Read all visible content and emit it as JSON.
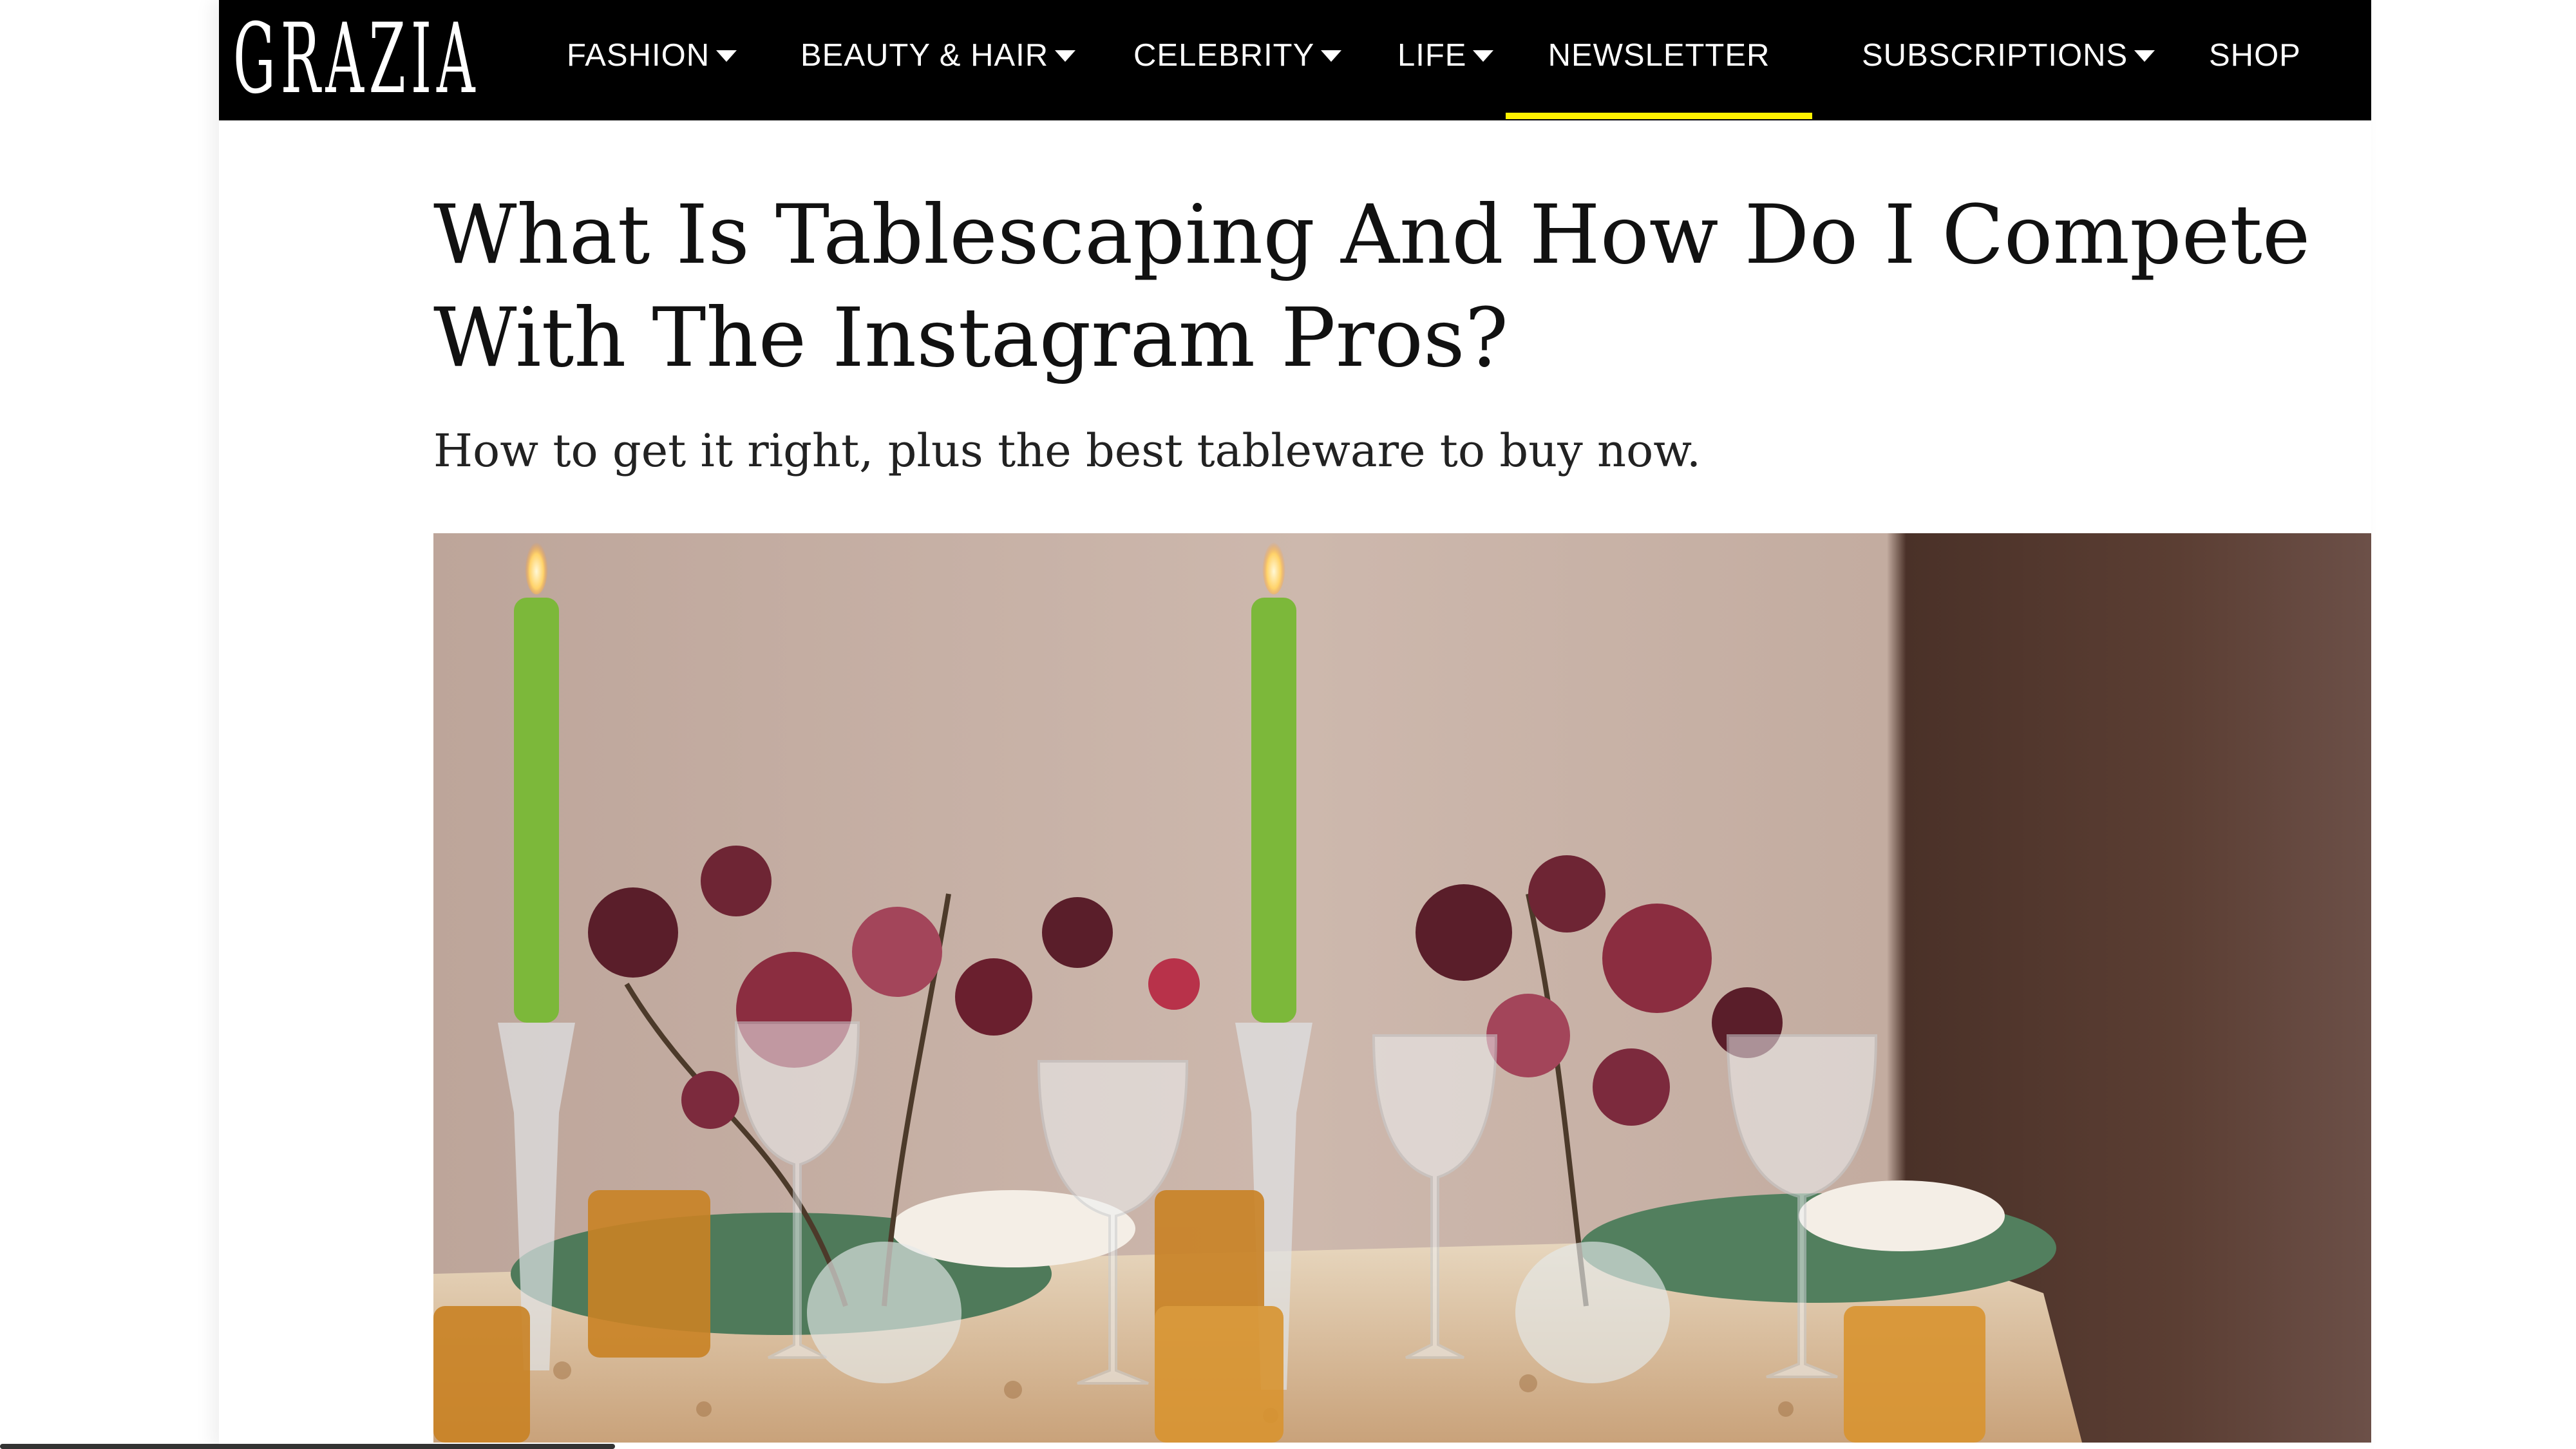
{
  "brand": {
    "logo_text": "GRAZIA"
  },
  "nav": {
    "items": [
      {
        "label": "FASHION",
        "has_dropdown": true
      },
      {
        "label": "BEAUTY & HAIR",
        "has_dropdown": true
      },
      {
        "label": "CELEBRITY",
        "has_dropdown": true
      },
      {
        "label": "LIFE",
        "has_dropdown": true
      },
      {
        "label": "NEWSLETTER",
        "has_dropdown": false,
        "active": true
      },
      {
        "label": "SUBSCRIPTIONS",
        "has_dropdown": true
      },
      {
        "label": "SHOP",
        "has_dropdown": false
      }
    ],
    "active_indicator_color": "#fff200"
  },
  "article": {
    "headline": "What Is Tablescaping And How Do I Compete With The Instagram Pros?",
    "standfirst": "How to get it right, plus the best tableware to buy now."
  },
  "colors": {
    "header_bg": "#000000",
    "page_bg": "#ffffff",
    "candle": "#7cb83a",
    "wall": "#c9b3a8"
  }
}
